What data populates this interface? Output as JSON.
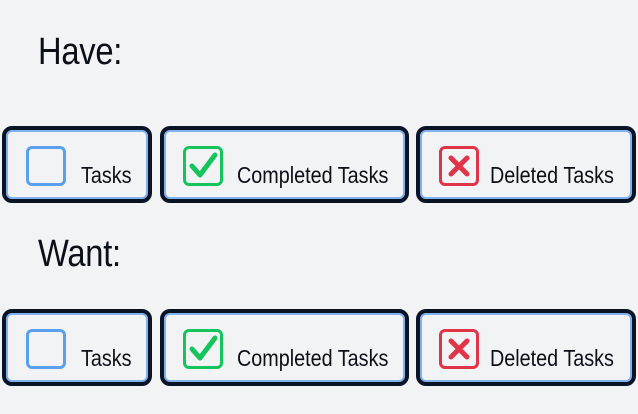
{
  "sections": [
    {
      "heading": "Have:",
      "buttons": [
        {
          "label": "Tasks",
          "icon": "empty-checkbox-icon",
          "color": "#5ba0ee"
        },
        {
          "label": "Completed Tasks",
          "icon": "checkmark-box-icon",
          "color": "#16c45e"
        },
        {
          "label": "Deleted Tasks",
          "icon": "x-box-icon",
          "color": "#e03448"
        }
      ]
    },
    {
      "heading": "Want:",
      "buttons": [
        {
          "label": "Tasks",
          "icon": "empty-checkbox-icon",
          "color": "#5ba0ee"
        },
        {
          "label": "Completed Tasks",
          "icon": "checkmark-box-icon",
          "color": "#16c45e"
        },
        {
          "label": "Deleted Tasks",
          "icon": "x-box-icon",
          "color": "#e03448"
        }
      ]
    }
  ],
  "colors": {
    "background": "#f2f3f5",
    "button_border": "#0a1424",
    "button_inner_outline": "#7fb2ee"
  }
}
